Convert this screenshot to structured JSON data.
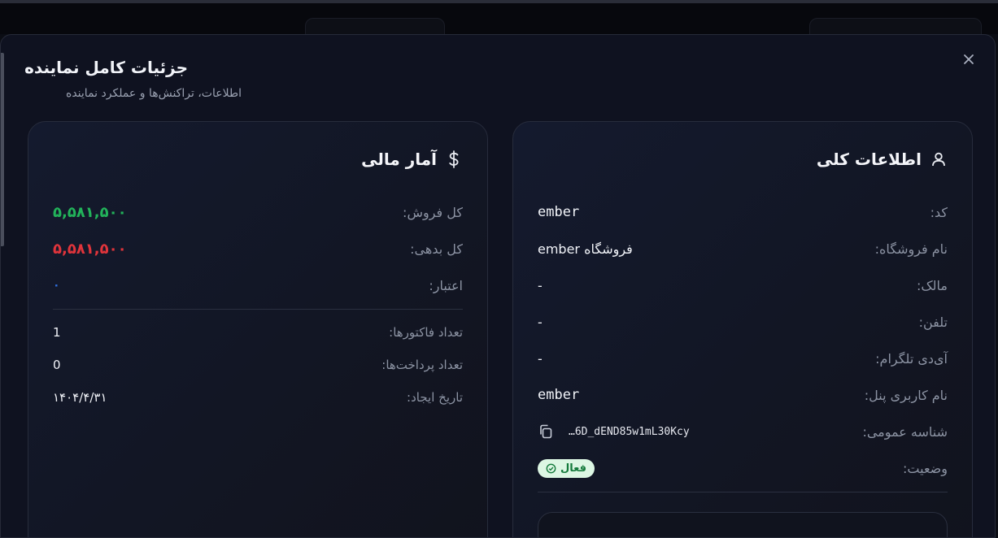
{
  "modal": {
    "title": "جزئیات کامل نماینده",
    "subtitle": "اطلاعات، تراکنش‌ها و عملکرد نماینده",
    "close_glyph": "×"
  },
  "general": {
    "title": "اطلاعات کلی",
    "icon": "user-icon",
    "rows": [
      {
        "label": "کد:",
        "value": "ember"
      },
      {
        "label": "نام فروشگاه:",
        "value": "فروشگاه ember"
      },
      {
        "label": "مالک:",
        "value": "-"
      },
      {
        "label": "تلفن:",
        "value": "-"
      },
      {
        "label": "آی‌دی تلگرام:",
        "value": "-"
      },
      {
        "label": "نام کاربری پنل:",
        "value": "ember"
      },
      {
        "label": "شناسه عمومی:",
        "value": "…6D_dEND85w1mL30Kcy"
      },
      {
        "label": "وضعیت:",
        "value": "فعال"
      }
    ]
  },
  "finance": {
    "title": "آمار مالی",
    "icon": "dollar-icon",
    "rows": [
      {
        "label": "کل فروش:",
        "value": "۵,۵۸۱,۵۰۰"
      },
      {
        "label": "کل بدهی:",
        "value": "۵,۵۸۱,۵۰۰"
      },
      {
        "label": "اعتبار:",
        "value": "۰"
      },
      {
        "label": "تعداد فاکتورها:",
        "value": "1"
      },
      {
        "label": "تعداد پرداخت‌ها:",
        "value": "0"
      },
      {
        "label": "تاریخ ایجاد:",
        "value": "۱۴۰۴/۴/۳۱"
      }
    ]
  },
  "colors": {
    "sales": "#22b35a",
    "debt": "#e0343b",
    "credit": "#2f6fe0",
    "active_badge_bg": "#dcf6e3",
    "active_badge_text": "#157a3c"
  }
}
